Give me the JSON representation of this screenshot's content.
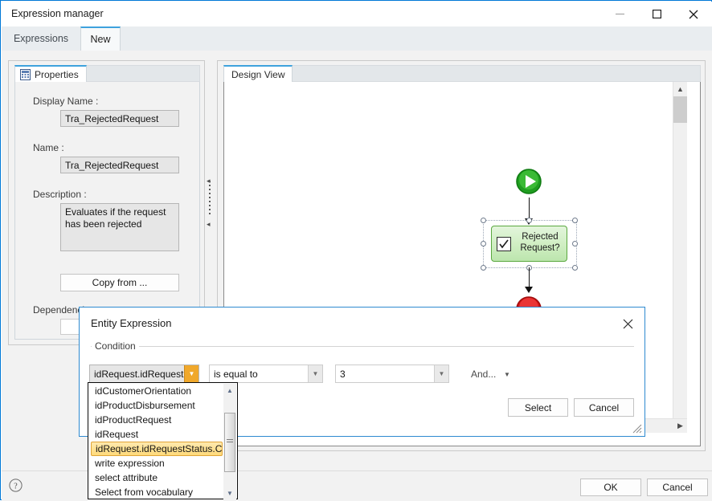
{
  "window": {
    "title": "Expression manager",
    "controls": [
      {
        "name": "minimize",
        "glyph": "minimize-icon"
      },
      {
        "name": "maximize",
        "glyph": "maximize-icon"
      },
      {
        "name": "close",
        "glyph": "close-icon"
      }
    ],
    "accent_color": "#0078d7"
  },
  "tabs": [
    {
      "label": "Expressions",
      "active": false
    },
    {
      "label": "New",
      "active": true
    }
  ],
  "properties_panel": {
    "tab_label": "Properties",
    "tab_icon": "properties-grid-icon",
    "fields": [
      {
        "label": "Display Name :",
        "value": "Tra_RejectedRequest"
      },
      {
        "label": "Name :",
        "value": "Tra_RejectedRequest"
      },
      {
        "label": "Description :",
        "value": "Evaluates if the request has been rejected"
      }
    ],
    "copy_from_button": "Copy from ...",
    "dependencies_label": "Dependencies :"
  },
  "design_view": {
    "tab_label": "Design View",
    "nodes": [
      {
        "type": "start",
        "name": "start-node",
        "label": ""
      },
      {
        "type": "task",
        "name": "decision-node",
        "label": "Rejected Request?",
        "selected": true
      },
      {
        "type": "end",
        "name": "end-node",
        "label": ""
      }
    ],
    "scroll": {
      "vertical": true,
      "horizontal": true
    }
  },
  "dialog": {
    "title": "Entity Expression",
    "close_label": "close-icon",
    "group_label": "Condition",
    "condition": {
      "attribute_value": "idRequest.idRequestS",
      "operator_value": "is equal to",
      "operand_value": "3",
      "conjunction_label": "And..."
    },
    "buttons": [
      {
        "label": "Select",
        "name": "select-button"
      },
      {
        "label": "Cancel",
        "name": "cancel-button"
      }
    ]
  },
  "dropdown": {
    "open": true,
    "selected_index": 4,
    "items": [
      "idCustomerOrientation",
      "idProductDisbursement",
      "idProductRequest",
      "idRequest",
      "idRequest.idRequestStatus.Co",
      "write expression",
      "select attribute",
      "Select from vocabulary"
    ]
  },
  "footer": {
    "help_icon": "help-icon",
    "ok_label": "OK",
    "cancel_label": "Cancel"
  }
}
